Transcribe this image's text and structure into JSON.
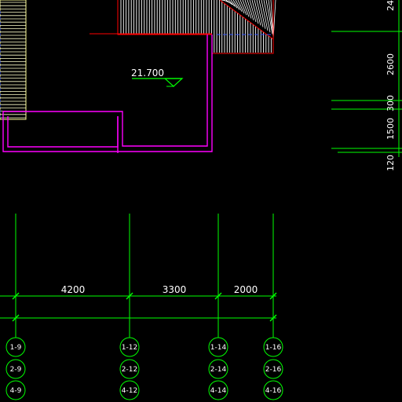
{
  "colors": {
    "background": "#000000",
    "grid_line": "#00ff00",
    "wall_outline": "#ff00ff",
    "slab_edge": "#ff0000",
    "hatch": "#ffffff",
    "stair_edge": "#ffff99",
    "hidden_line": "#3355ff",
    "text": "#ffffff"
  },
  "elevation_marker": {
    "value": "21.700"
  },
  "horizontal_dimensions": [
    "4200",
    "3300",
    "2000"
  ],
  "vertical_dimensions": [
    "24",
    "2600",
    "300",
    "1500",
    "120"
  ],
  "axis_bubbles": [
    [
      "1-9",
      "2-9",
      "4-9"
    ],
    [
      "1-12",
      "2-12",
      "4-12"
    ],
    [
      "1-14",
      "2-14",
      "4-14"
    ],
    [
      "1-16",
      "2-16",
      "4-16"
    ]
  ]
}
